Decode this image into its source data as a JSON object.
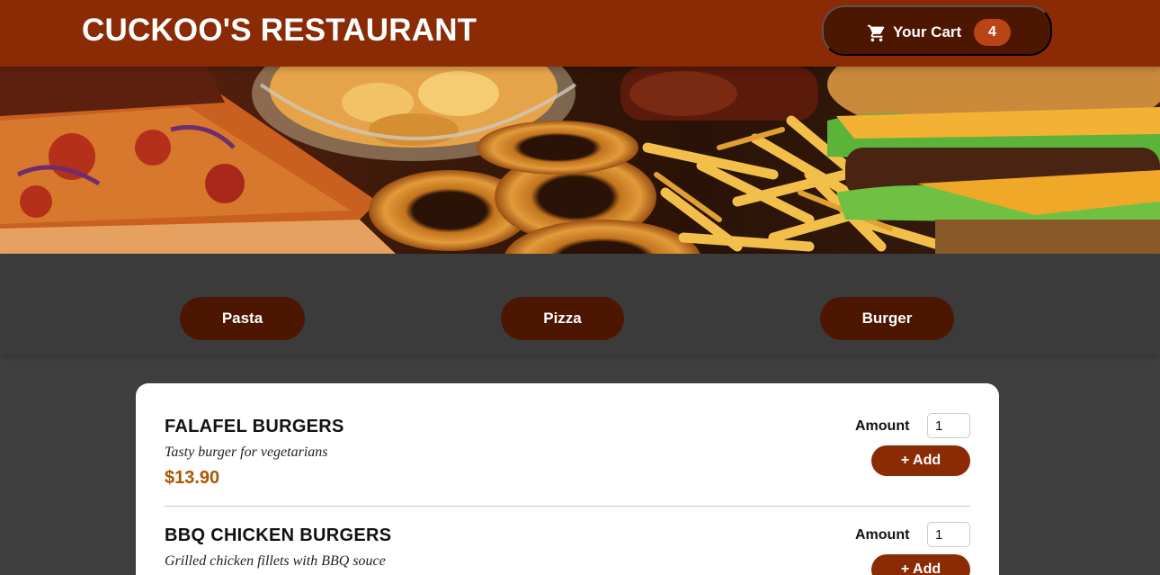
{
  "header": {
    "title": "CUCKOO'S RESTAURANT",
    "cart": {
      "label": "Your Cart",
      "count": "4",
      "icon": "shopping-cart-icon"
    },
    "colors": {
      "background": "#8a2b06",
      "cart_background": "#4d1601",
      "badge": "#b94517"
    }
  },
  "hero": {
    "description_icon": "food-banner"
  },
  "categories": [
    {
      "label": "Pasta"
    },
    {
      "label": "Pizza"
    },
    {
      "label": "Burger"
    }
  ],
  "meals": [
    {
      "name": "FALAFEL BURGERS",
      "description": "Tasty burger for vegetarians",
      "price": "$13.90",
      "amount_label": "Amount",
      "amount_value": "1",
      "add_label": "+ Add"
    },
    {
      "name": "BBQ CHICKEN BURGERS",
      "description": "Grilled chicken fillets with BBQ souce",
      "price": "",
      "amount_label": "Amount",
      "amount_value": "1",
      "add_label": "+ Add"
    }
  ],
  "colors": {
    "page_background": "#3f3f3f",
    "price": "#ad5502",
    "accent": "#8a2b06"
  }
}
